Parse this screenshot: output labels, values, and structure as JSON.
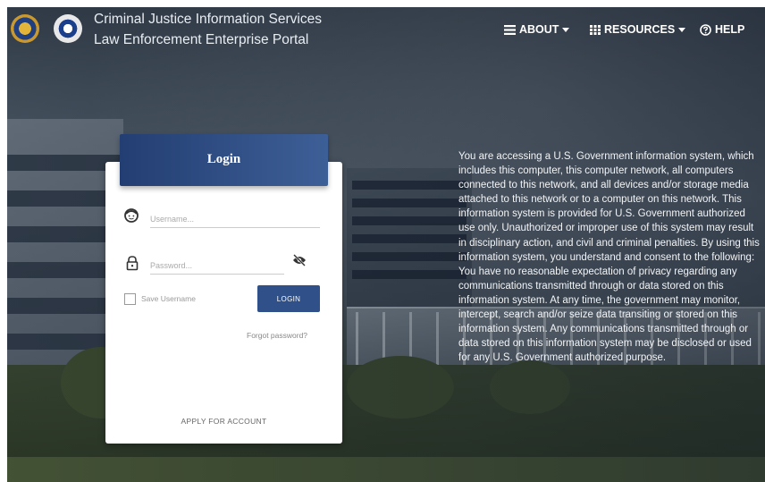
{
  "header": {
    "title_line1": "Criminal Justice Information Services",
    "title_line2": "Law Enforcement Enterprise Portal",
    "nav": {
      "about": "ABOUT",
      "resources": "RESOURCES",
      "help": "HELP"
    }
  },
  "login": {
    "heading": "Login",
    "username_placeholder": "Username...",
    "password_placeholder": "Password...",
    "save_username_label": "Save Username",
    "login_button": "LOGIN",
    "forgot_password": "Forgot password?",
    "apply_for_account": "APPLY FOR ACCOUNT"
  },
  "notice": {
    "text": "You are accessing a U.S. Government information system, which includes this computer, this computer network, all computers connected to this network, and all devices and/or storage media attached to this network or to a computer on this network. This information system is provided for U.S. Government authorized use only. Unauthorized or improper use of this system may result in disciplinary action, and civil and criminal penalties. By using this information system, you understand and consent to the following: You have no reasonable expectation of privacy regarding any communications transmitted through or data stored on this information system. At any time, the government may monitor, intercept, search and/or seize data transiting or stored on this information system. Any communications transmitted through or data stored on this information system may be disclosed or used for any U.S. Government authorized purpose."
  },
  "icons": {
    "seal_left": "cjis-seal-icon",
    "seal_right": "fbi-seal-icon",
    "menu": "hamburger-menu-icon",
    "grid": "grid-icon",
    "help": "question-circle-icon",
    "user": "user-face-icon",
    "lock": "lock-icon",
    "eye": "eye-slash-icon"
  }
}
